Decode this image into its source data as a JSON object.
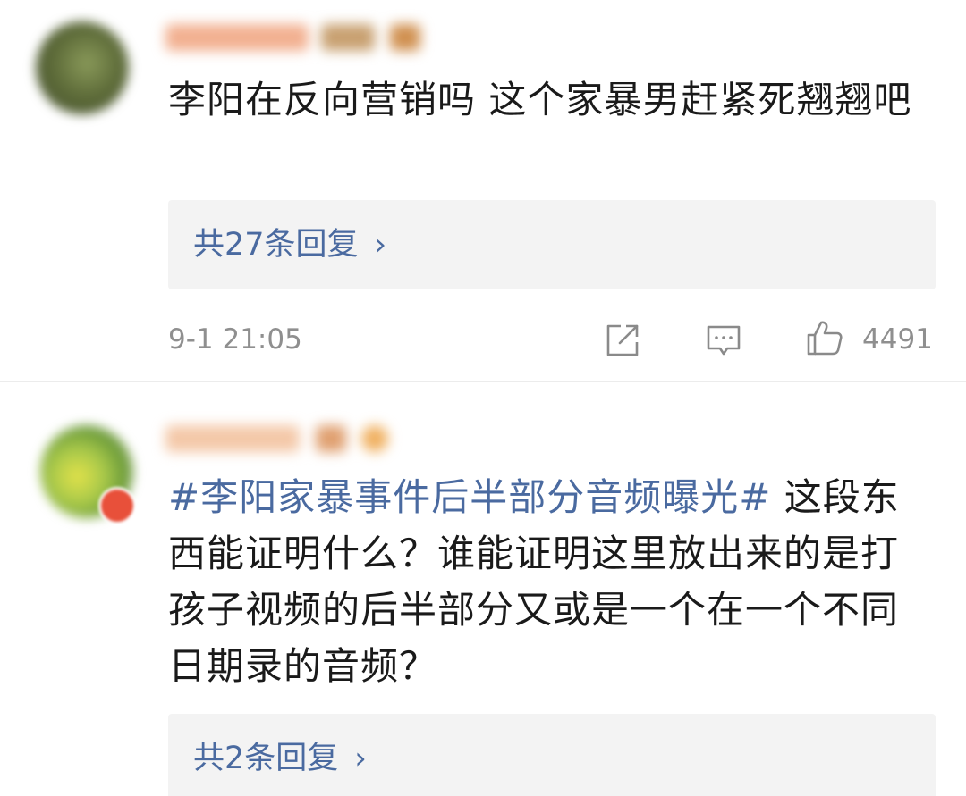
{
  "comments": [
    {
      "text": "李阳在反向营销吗 这个家暴男赶紧死翘翘吧",
      "replies_label": "共27条回复",
      "timestamp": "9-1 21:05",
      "likes": "4491"
    },
    {
      "hashtag": "#李阳家暴事件后半部分音频曝光#",
      "text": " 这段东西能证明什么？谁能证明这里放出来的是打孩子视频的后半部分又或是一个在一个不同日期录的音频？",
      "replies_label": "共2条回复"
    }
  ],
  "icons": {
    "chevron": "›",
    "share": "share-icon",
    "comment": "comment-icon",
    "like": "thumbs-up-icon"
  },
  "colors": {
    "link": "#4a6aa0",
    "meta": "#8f8f8f",
    "text": "#1a1a1a",
    "reply_bg": "#f3f3f3"
  }
}
